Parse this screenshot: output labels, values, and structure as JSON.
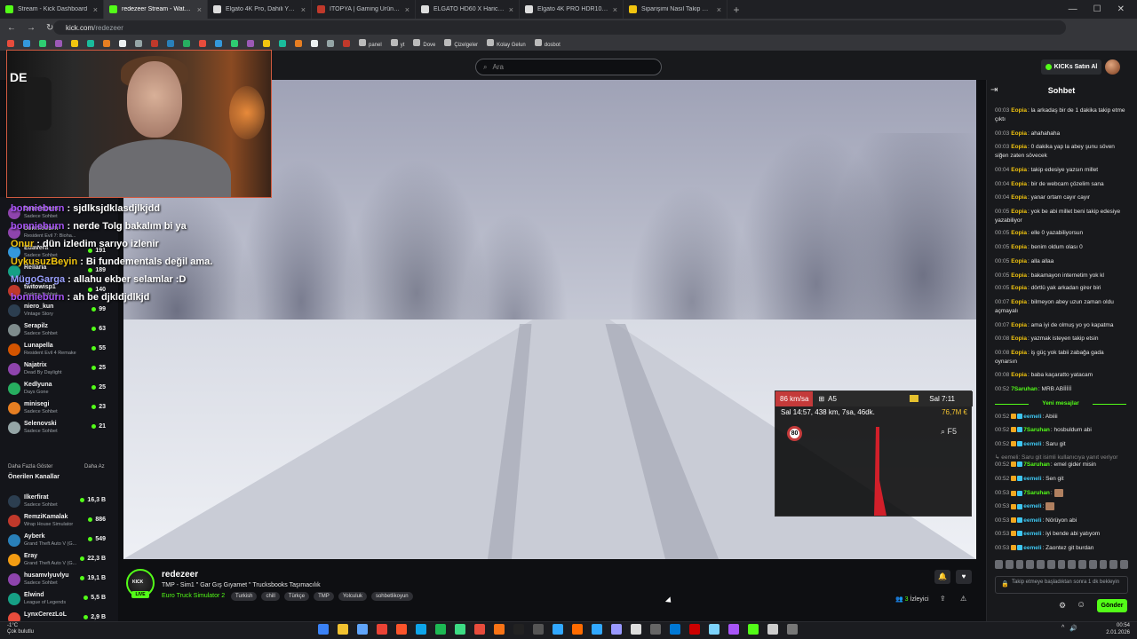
{
  "browser": {
    "tabs": [
      {
        "title": "Stream - Kick Dashboard",
        "color": "#53fc18"
      },
      {
        "title": "redezeer Stream - Watch Live o",
        "color": "#53fc18",
        "active": true
      },
      {
        "title": "Elgato 4K Pro, Dahili Yakalama",
        "color": "#dddddd"
      },
      {
        "title": "ITOPYA | Gaming Ürünler ve Bil",
        "color": "#c0392b"
      },
      {
        "title": "ELGATO HD60 X Harici Görüntü",
        "color": "#dddddd"
      },
      {
        "title": "Elgato 4K PRO HDR10 PCIe Has",
        "color": "#dddddd"
      },
      {
        "title": "Siparişimi Nasıl Takip Edebilirim",
        "color": "#f1c40f"
      }
    ],
    "url_host": "kick.com",
    "url_path": "/redezeer",
    "bookmarks": [
      "panel",
      "yt",
      "Dove",
      "Çizelgeler",
      "Kolay Gelun",
      "dosbot"
    ]
  },
  "header": {
    "search_placeholder": "Ara",
    "kicks_button": "KICKs Satın Al"
  },
  "overlay_chat": [
    {
      "user": "bonnieburn",
      "text": ": sjdlksjdklasdjlkjdd",
      "color": "#a855f7"
    },
    {
      "user": "bonnieburn",
      "text": ": nerde Tolg bakalım bi ya",
      "color": "#a855f7"
    },
    {
      "user": "Onur",
      "text": ": dün izledim sarıyo izlenir",
      "color": "#f1c40f"
    },
    {
      "user": "UykusuzBeyin",
      "text": ": Bi fundementals değil ama.",
      "color": "#f1c40f"
    },
    {
      "user": "MügoGarga",
      "text": ": allahu ekber selamlar :D",
      "color": "#9aa0ff"
    },
    {
      "user": "bonnieburn",
      "text": ": ah be djkldjdlkjd",
      "color": "#a855f7"
    }
  ],
  "sidebar": {
    "followed": [
      {
        "name": "bonnieburn",
        "game": "Sadece Sohbet",
        "viewers": "",
        "color": "#8e44ad"
      },
      {
        "name": "bonnieburn",
        "game": "Resident Evil 7: Bioha...",
        "viewers": "",
        "color": "#8e44ad"
      },
      {
        "name": "Edavera",
        "game": "Sadece Sohbet",
        "viewers": "191",
        "color": "#3498db"
      },
      {
        "name": "Rellaria",
        "game": "",
        "viewers": "189",
        "color": "#16a085"
      },
      {
        "name": "twitowisp1",
        "game": "Sadece Sohbet",
        "viewers": "140",
        "color": "#c0392b"
      },
      {
        "name": "niero_kun",
        "game": "Vintage Story",
        "viewers": "99",
        "color": "#2c3e50"
      },
      {
        "name": "Serapilz",
        "game": "Sadece Sohbet",
        "viewers": "63",
        "color": "#7f8c8d"
      },
      {
        "name": "Lunapella",
        "game": "Resident Evil 4 Remake",
        "viewers": "55",
        "color": "#d35400"
      },
      {
        "name": "Najatrix",
        "game": "Dead By Daylight",
        "viewers": "25",
        "color": "#8e44ad"
      },
      {
        "name": "Kedlyuna",
        "game": "Days Gone",
        "viewers": "25",
        "color": "#27ae60"
      },
      {
        "name": "minisegi",
        "game": "Sadece Sohbet",
        "viewers": "23",
        "color": "#e67e22"
      },
      {
        "name": "Selenovski",
        "game": "Sadece Sohbet",
        "viewers": "21",
        "color": "#95a5a6"
      }
    ],
    "show_more": "Daha Fazla Göster",
    "show_less": "Daha Az",
    "recommended_heading": "Önerilen Kanallar",
    "recommended": [
      {
        "name": "Ilkerfirat",
        "game": "Sadece Sohbet",
        "viewers": "16,3 B",
        "color": "#2c3e50"
      },
      {
        "name": "RemziKamalak",
        "game": "Wrap House Simulator",
        "viewers": "886",
        "color": "#c0392b"
      },
      {
        "name": "Ayberk",
        "game": "Grand Theft Auto V (G...",
        "viewers": "549",
        "color": "#2980b9"
      },
      {
        "name": "Eray",
        "game": "Grand Theft Auto V (G...",
        "viewers": "22,3 B",
        "color": "#f39c12"
      },
      {
        "name": "husamvlyuvlyu",
        "game": "Sadece Sohbet",
        "viewers": "19,1 B",
        "color": "#8e44ad"
      },
      {
        "name": "Elwind",
        "game": "League of Legends",
        "viewers": "5,5 B",
        "color": "#16a085"
      },
      {
        "name": "LynxCerezLoL",
        "game": "",
        "viewers": "2,9 B",
        "color": "#e74c3c"
      }
    ]
  },
  "hud": {
    "speed": "86 km/sa",
    "road": "A5",
    "game_time": "Sal 7:11",
    "info": "Sal 14:57, 438 km, 7sa, 46dk.",
    "money": "76,7M €",
    "speed_limit": "80",
    "map_key": "F5"
  },
  "chat": {
    "title": "Sohbet",
    "messages": [
      {
        "t": "00:03",
        "u": "Eopia",
        "m": "la arkadaş bir de 1 dakika takip etme çıktı",
        "c": "#f1c40f"
      },
      {
        "t": "00:03",
        "u": "Eopia",
        "m": "ahahahaha",
        "c": "#f1c40f"
      },
      {
        "t": "00:03",
        "u": "Eopia",
        "m": "0 dakika yap la abey şunu söven siğen zaten sövecek",
        "c": "#f1c40f"
      },
      {
        "t": "00:04",
        "u": "Eopia",
        "m": "takip edesiye yazsın millet",
        "c": "#f1c40f"
      },
      {
        "t": "00:04",
        "u": "Eopia",
        "m": "bir de webcam çözelim sana",
        "c": "#f1c40f"
      },
      {
        "t": "00:04",
        "u": "Eopia",
        "m": "yanar ortam cayır cayır",
        "c": "#f1c40f"
      },
      {
        "t": "00:05",
        "u": "Eopia",
        "m": "yok be abi millet beni takip edesiye yazabiliyor",
        "c": "#f1c40f"
      },
      {
        "t": "00:05",
        "u": "Eopia",
        "m": "elle 0 yazabiliyorsun",
        "c": "#f1c40f"
      },
      {
        "t": "00:05",
        "u": "Eopia",
        "m": "benim oldum olası 0",
        "c": "#f1c40f"
      },
      {
        "t": "00:05",
        "u": "Eopia",
        "m": "alla allaa",
        "c": "#f1c40f"
      },
      {
        "t": "00:05",
        "u": "Eopia",
        "m": "bakamayon internetim yok kl",
        "c": "#f1c40f"
      },
      {
        "t": "00:05",
        "u": "Eopia",
        "m": "dörtlü yak arkadan girer biri",
        "c": "#f1c40f"
      },
      {
        "t": "00:07",
        "u": "Eopia",
        "m": "bilmeyon abey uzun zaman oldu açmayalı",
        "c": "#f1c40f"
      },
      {
        "t": "00:07",
        "u": "Eopia",
        "m": "ama iyi de olmuş yo yo kapatma",
        "c": "#f1c40f"
      },
      {
        "t": "00:08",
        "u": "Eopia",
        "m": "yazmak isteyen takip etsin",
        "c": "#f1c40f"
      },
      {
        "t": "00:08",
        "u": "Eopia",
        "m": "iş güç yok tabii zabağa gada oynarsın",
        "c": "#f1c40f"
      },
      {
        "t": "00:08",
        "u": "Eopia",
        "m": "baba kaçaratto yatacam",
        "c": "#f1c40f"
      },
      {
        "t": "00:52",
        "u": "7Saruhan",
        "m": "MRB ABİİİİİ",
        "c": "#53fc18"
      }
    ],
    "new_messages_label": "Yeni mesajlar",
    "new_messages": [
      {
        "t": "00:52",
        "u": "eemeli",
        "m": "Abiiii",
        "c": "#3ec6f0"
      },
      {
        "t": "00:52",
        "u": "7Saruhan",
        "m": "hosbuldum abi",
        "c": "#53fc18"
      },
      {
        "t": "00:52",
        "u": "eemeli",
        "m": "Saru git",
        "c": "#3ec6f0"
      },
      {
        "t": "",
        "u": "",
        "m": "↳ eemeli: Saru git isimli kullanıcıya yanıt veriyor",
        "c": "#888888"
      },
      {
        "t": "00:52",
        "u": "7Saruhan",
        "m": "emel gider misin",
        "c": "#53fc18"
      },
      {
        "t": "00:52",
        "u": "eemeli",
        "m": "Sen git",
        "c": "#3ec6f0"
      },
      {
        "t": "00:53",
        "u": "7Saruhan",
        "m": "",
        "c": "#53fc18"
      },
      {
        "t": "00:53",
        "u": "eemeli",
        "m": "",
        "c": "#3ec6f0"
      },
      {
        "t": "00:53",
        "u": "eemeli",
        "m": "Nörüyon abi",
        "c": "#3ec6f0"
      },
      {
        "t": "00:53",
        "u": "eemeli",
        "m": "iyi bende abi yatıyom",
        "c": "#3ec6f0"
      },
      {
        "t": "00:53",
        "u": "eemeli",
        "m": "Zaontez git burdan",
        "c": "#3ec6f0"
      }
    ],
    "input_placeholder": "Takip etmeye başladıktan sonra 1 dk bekleyin",
    "send_label": "Gönder"
  },
  "stream": {
    "name": "redezeer",
    "title": "TMP - Sim1 \" Gar Gış Gıyamet \" Trucksbooks Taşımacılık",
    "game": "Euro Truck Simulator 2",
    "tags": [
      "Turkish",
      "chill",
      "Türkçe",
      "TMP",
      "Yolculuk",
      "sohbetlikoyun"
    ],
    "live_label": "LIVE",
    "viewers": "3",
    "viewers_label": "İzleyici"
  },
  "taskbar": {
    "weather_temp": "-1°C",
    "weather_text": "Çok bulutlu",
    "time": "00:54",
    "date": "2.01.2026"
  }
}
